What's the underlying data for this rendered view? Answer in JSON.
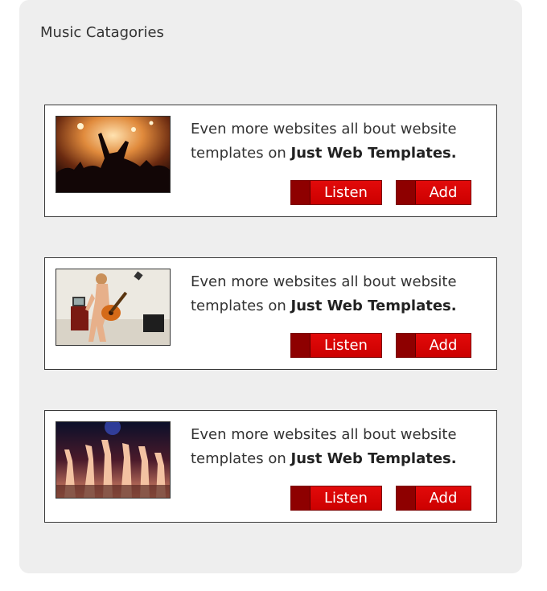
{
  "panel": {
    "title": "Music Catagories"
  },
  "cards": [
    {
      "image_icon": "concert-crowd-icon",
      "text_start": "Even more websites all bout website templates on ",
      "text_bold": "Just Web Templates.",
      "listen_label": "Listen",
      "add_label": "Add"
    },
    {
      "image_icon": "guitar-player-icon",
      "text_start": "Even more websites all bout website templates on ",
      "text_bold": "Just Web Templates.",
      "listen_label": "Listen",
      "add_label": "Add"
    },
    {
      "image_icon": "raised-hands-crowd-icon",
      "text_start": "Even more websites all bout website templates on ",
      "text_bold": "Just Web Templates.",
      "listen_label": "Listen",
      "add_label": "Add"
    }
  ],
  "colors": {
    "button_red": "#d90000",
    "button_dark": "#8e0000",
    "panel_bg": "#eeeeee"
  }
}
